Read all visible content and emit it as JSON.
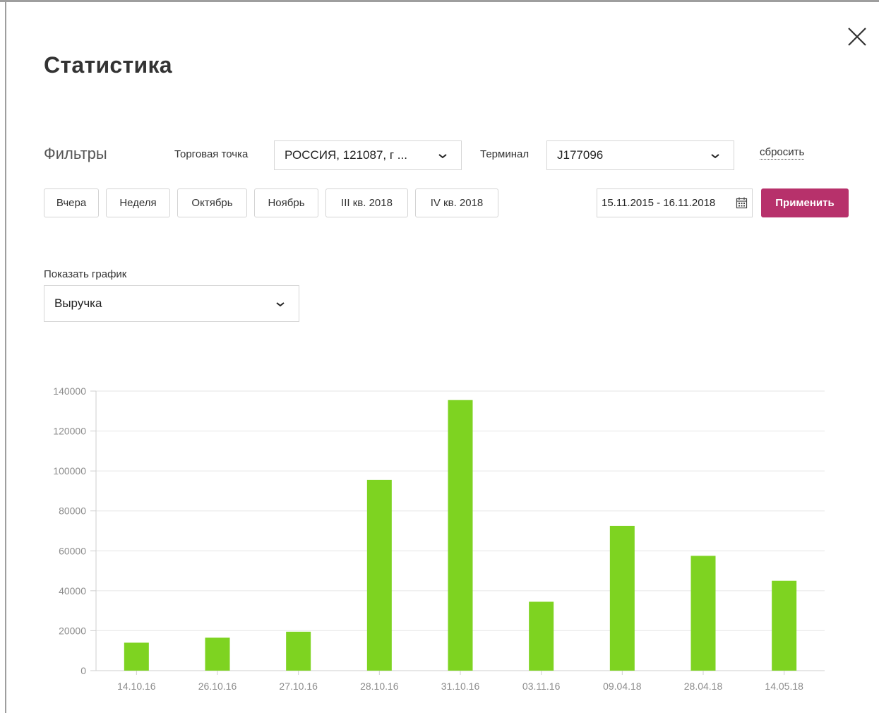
{
  "dialog": {
    "title": "Статистика"
  },
  "filters": {
    "label": "Фильтры",
    "store": {
      "label": "Торговая точка",
      "value": "РОССИЯ, 121087, г ..."
    },
    "terminal": {
      "label": "Терминал",
      "value": "J177096"
    },
    "reset_label": "сбросить",
    "quick_ranges": [
      "Вчера",
      "Неделя",
      "Октябрь",
      "Ноябрь",
      "III кв. 2018",
      "IV кв. 2018"
    ],
    "date_range": "15.11.2015 - 16.11.2018",
    "apply_label": "Применить"
  },
  "graph_selector": {
    "label": "Показать график",
    "value": "Выручка"
  },
  "colors": {
    "accent": "#b7316b",
    "bar": "#7ed321",
    "grid": "#e6e6e6",
    "axis_text": "#8c8c8c"
  },
  "chart_data": {
    "type": "bar",
    "categories": [
      "14.10.16",
      "26.10.16",
      "27.10.16",
      "28.10.16",
      "31.10.16",
      "03.11.16",
      "09.04.18",
      "28.04.18",
      "14.05.18"
    ],
    "values": [
      14000,
      16500,
      19500,
      95500,
      135500,
      34500,
      72500,
      57500,
      45000
    ],
    "ylim": [
      0,
      140000
    ],
    "yticks": [
      0,
      20000,
      40000,
      60000,
      80000,
      100000,
      120000,
      140000
    ],
    "grid": true
  }
}
